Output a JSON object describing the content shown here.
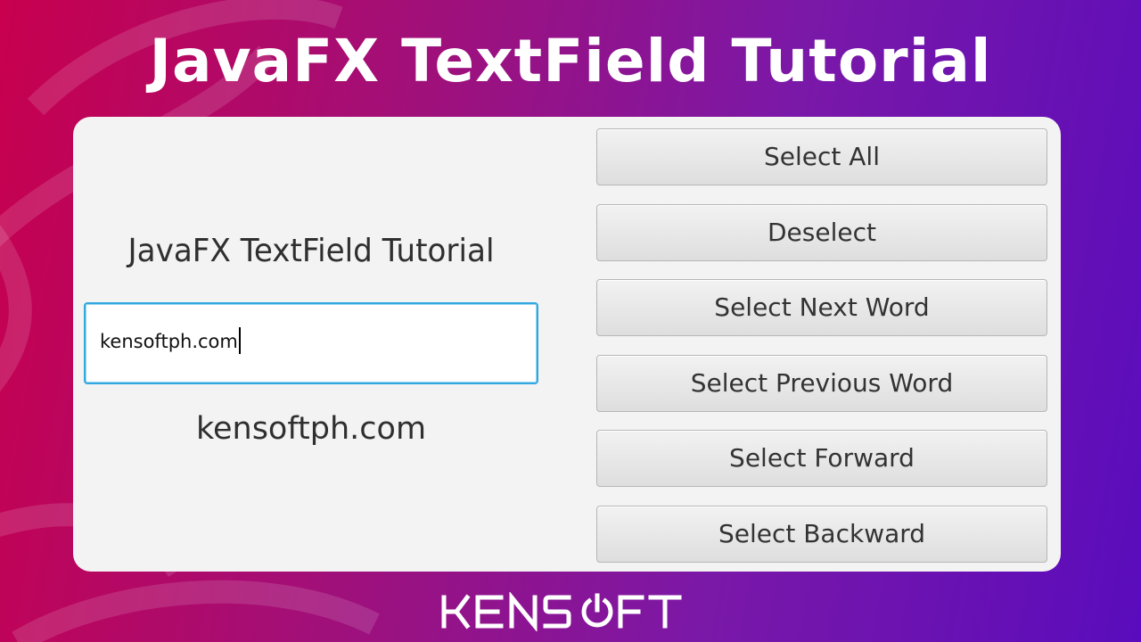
{
  "banner": {
    "title": "JavaFX TextField Tutorial"
  },
  "app": {
    "label": "JavaFX TextField Tutorial",
    "text_field": {
      "value": "kensoftph.com"
    },
    "output_label": "kensoftph.com",
    "buttons": [
      {
        "label": "Select All"
      },
      {
        "label": "Deselect"
      },
      {
        "label": "Select Next Word"
      },
      {
        "label": "Select Previous Word"
      },
      {
        "label": "Select Forward"
      },
      {
        "label": "Select Backward"
      }
    ]
  },
  "brand": {
    "logo_text": "KENSOFT",
    "logo_icon": "power-icon"
  },
  "colors": {
    "gradient_start": "#c8004e",
    "gradient_end": "#5a0cbc",
    "focus_border": "#32a8e0",
    "panel_bg": "#f3f3f3"
  }
}
